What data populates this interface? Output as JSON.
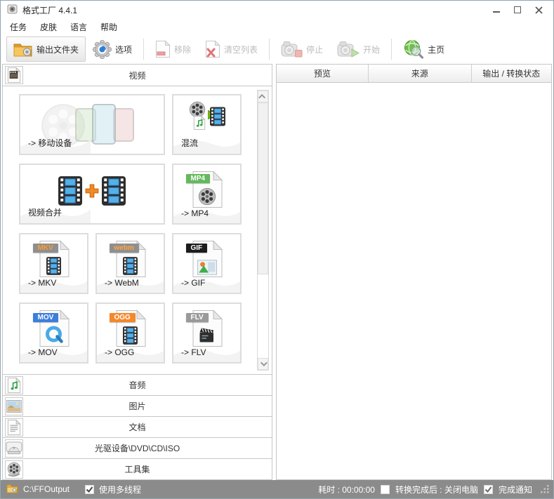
{
  "window": {
    "title": "格式工厂 4.4.1"
  },
  "menu": [
    "任务",
    "皮肤",
    "语言",
    "帮助"
  ],
  "toolbar": {
    "output_folder": "输出文件夹",
    "options": "选项",
    "remove": "移除",
    "clear_list": "清空列表",
    "stop": "停止",
    "start": "开始",
    "home": "主页"
  },
  "video_panel": {
    "title": "视频",
    "cards": [
      {
        "label": "-> 移动设备"
      },
      {
        "label": "混流"
      },
      {
        "label": "视频合并"
      },
      {
        "label": "-> MP4",
        "badge": "MP4"
      },
      {
        "label": "-> MKV",
        "badge": "MKV"
      },
      {
        "label": "-> WebM",
        "badge": "webm"
      },
      {
        "label": "-> GIF",
        "badge": "GIF"
      },
      {
        "label": "-> MOV",
        "badge": "MOV"
      },
      {
        "label": "-> OGG",
        "badge": "OGG"
      },
      {
        "label": "-> FLV",
        "badge": "FLV"
      }
    ]
  },
  "categories": [
    {
      "label": "音频"
    },
    {
      "label": "图片"
    },
    {
      "label": "文档"
    },
    {
      "label": "光驱设备\\DVD\\CD\\ISO"
    },
    {
      "label": "工具集"
    }
  ],
  "queue_panel": {
    "columns": [
      "预览",
      "来源",
      "输出 / 转换状态"
    ]
  },
  "statusbar": {
    "output_path": "C:\\FFOutput",
    "multithread": "使用多线程",
    "elapsed": "耗时 : 00:00:00",
    "shutdown_after": "转换完成后 : 关闭电脑",
    "notify": "完成通知"
  },
  "colors": {
    "statusbar_bg": "#8b8b8b",
    "badge_mp4": "#64b95c",
    "badge_mov": "#3d7edb",
    "badge_ogg": "#f5882b",
    "badge_gif": "#1c1c1c",
    "accent_orange": "#f08a24",
    "film_blue": "#56b0e8",
    "globe_green": "#6fbf4a"
  }
}
